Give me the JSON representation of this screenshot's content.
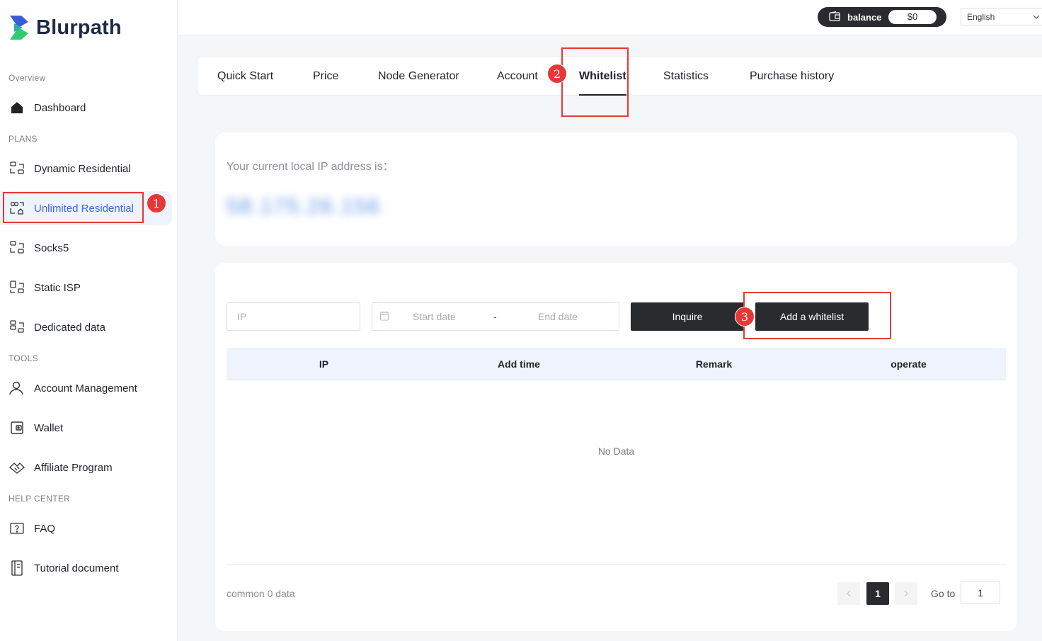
{
  "brand": {
    "name": "Blurpath"
  },
  "sidebar": {
    "sections": {
      "overview": "Overview",
      "plans": "PLANS",
      "tools": "TOOLS",
      "help": "HELP CENTER"
    },
    "items": [
      {
        "label": "Dashboard",
        "icon": "home-icon"
      },
      {
        "label": "Dynamic Residential",
        "icon": "network-icon"
      },
      {
        "label": "Unlimited Residential",
        "icon": "infinity-network-icon",
        "active": true
      },
      {
        "label": "Socks5",
        "icon": "network-icon"
      },
      {
        "label": "Static ISP",
        "icon": "network-icon"
      },
      {
        "label": "Dedicated data",
        "icon": "network-icon"
      },
      {
        "label": "Account Management",
        "icon": "user-icon"
      },
      {
        "label": "Wallet",
        "icon": "wallet-icon"
      },
      {
        "label": "Affiliate Program",
        "icon": "handshake-icon"
      },
      {
        "label": "FAQ",
        "icon": "question-icon"
      },
      {
        "label": "Tutorial document",
        "icon": "document-icon"
      }
    ]
  },
  "topbar": {
    "balance_label": "balance",
    "balance_value": "$0",
    "language": "English"
  },
  "tabs": [
    "Quick Start",
    "Price",
    "Node Generator",
    "Account",
    "Whitelist",
    "Statistics",
    "Purchase history"
  ],
  "active_tab": "Whitelist",
  "ip_card": {
    "label": "Your current local IP address is：",
    "value": "58.175.26.156"
  },
  "filters": {
    "ip_placeholder": "IP",
    "start_placeholder": "Start date",
    "separator": "-",
    "end_placeholder": "End date",
    "inquire_label": "Inquire",
    "add_label": "Add a whitelist"
  },
  "table": {
    "columns": [
      "IP",
      "Add time",
      "Remark",
      "operate"
    ],
    "empty_text": "No Data"
  },
  "pagination": {
    "total_text": "common 0 data",
    "current_page": "1",
    "goto_label": "Go to",
    "goto_value": "1"
  },
  "annotations": [
    "1",
    "2",
    "3"
  ],
  "colors": {
    "accent": "#3c68d8",
    "dark": "#2a2b2e",
    "annotation": "#e53935",
    "brand_blue": "#3a5bd9",
    "brand_green": "#2ecc71"
  }
}
